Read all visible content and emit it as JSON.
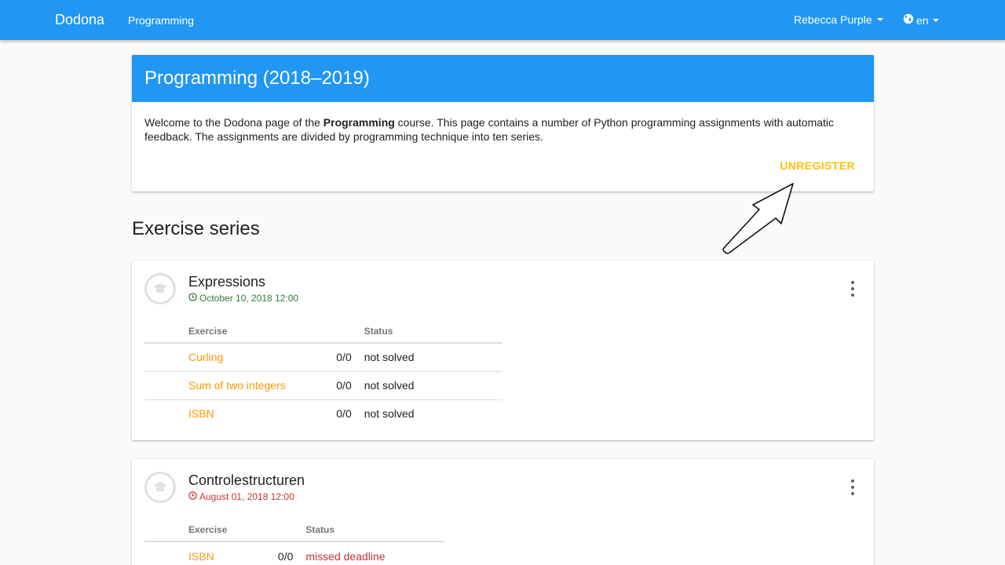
{
  "nav": {
    "brand": "Dodona",
    "link": "Programming",
    "user": "Rebecca Purple",
    "lang": "en"
  },
  "course": {
    "title": "Programming (2018–2019)",
    "desc_before": "Welcome to the Dodona page of the ",
    "desc_bold": "Programming",
    "desc_after": " course. This page contains a number of Python programming assignments with automatic feedback. The assignments are divided by programming technique into ten series.",
    "unregister": "UNREGISTER"
  },
  "series_heading": "Exercise series",
  "table_headers": {
    "exercise": "Exercise",
    "status": "Status"
  },
  "series": [
    {
      "name": "Expressions",
      "deadline": "October 10, 2018 12:00",
      "exercises": [
        {
          "name": "Curling",
          "score": "0/0",
          "status": "not solved"
        },
        {
          "name": "Sum of two integers",
          "score": "0/0",
          "status": "not solved"
        },
        {
          "name": "ISBN",
          "score": "0/0",
          "status": "not solved"
        }
      ]
    },
    {
      "name": "Controlestructuren",
      "deadline": "August 01, 2018 12:00",
      "exercises": [
        {
          "name": "ISBN",
          "score": "0/0",
          "status": "missed deadline"
        }
      ]
    }
  ],
  "colors": {
    "primary": "#2196f3",
    "accent_link": "#ff9800",
    "unregister": "#ffc107",
    "deadline_ok": "#2e7d32",
    "deadline_missed": "#d32f2f"
  }
}
